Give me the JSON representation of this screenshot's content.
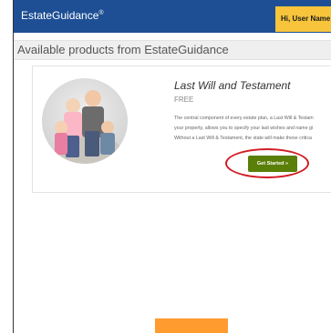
{
  "header": {
    "brand": "EstateGuidance",
    "brand_mark": "®",
    "user_label": "Hi, User Name"
  },
  "subheader": {
    "title": "Available products from EstateGuidance"
  },
  "product": {
    "title": "Last Will and Testament",
    "price": "FREE",
    "description_lines": [
      "The central component of every estate plan, a Last Will & Testam",
      "your property, allows you to specify your last wishes and name gi",
      "Without a Last Will & Testament, the state will make these critica"
    ],
    "cta_label": "Get Started »"
  },
  "colors": {
    "header_bg": "#1e4f94",
    "user_tab_bg": "#f7c43b",
    "button_bg": "#5a7f08",
    "highlight_ring": "#d21c25",
    "orange_tab": "#ff9b2f"
  }
}
